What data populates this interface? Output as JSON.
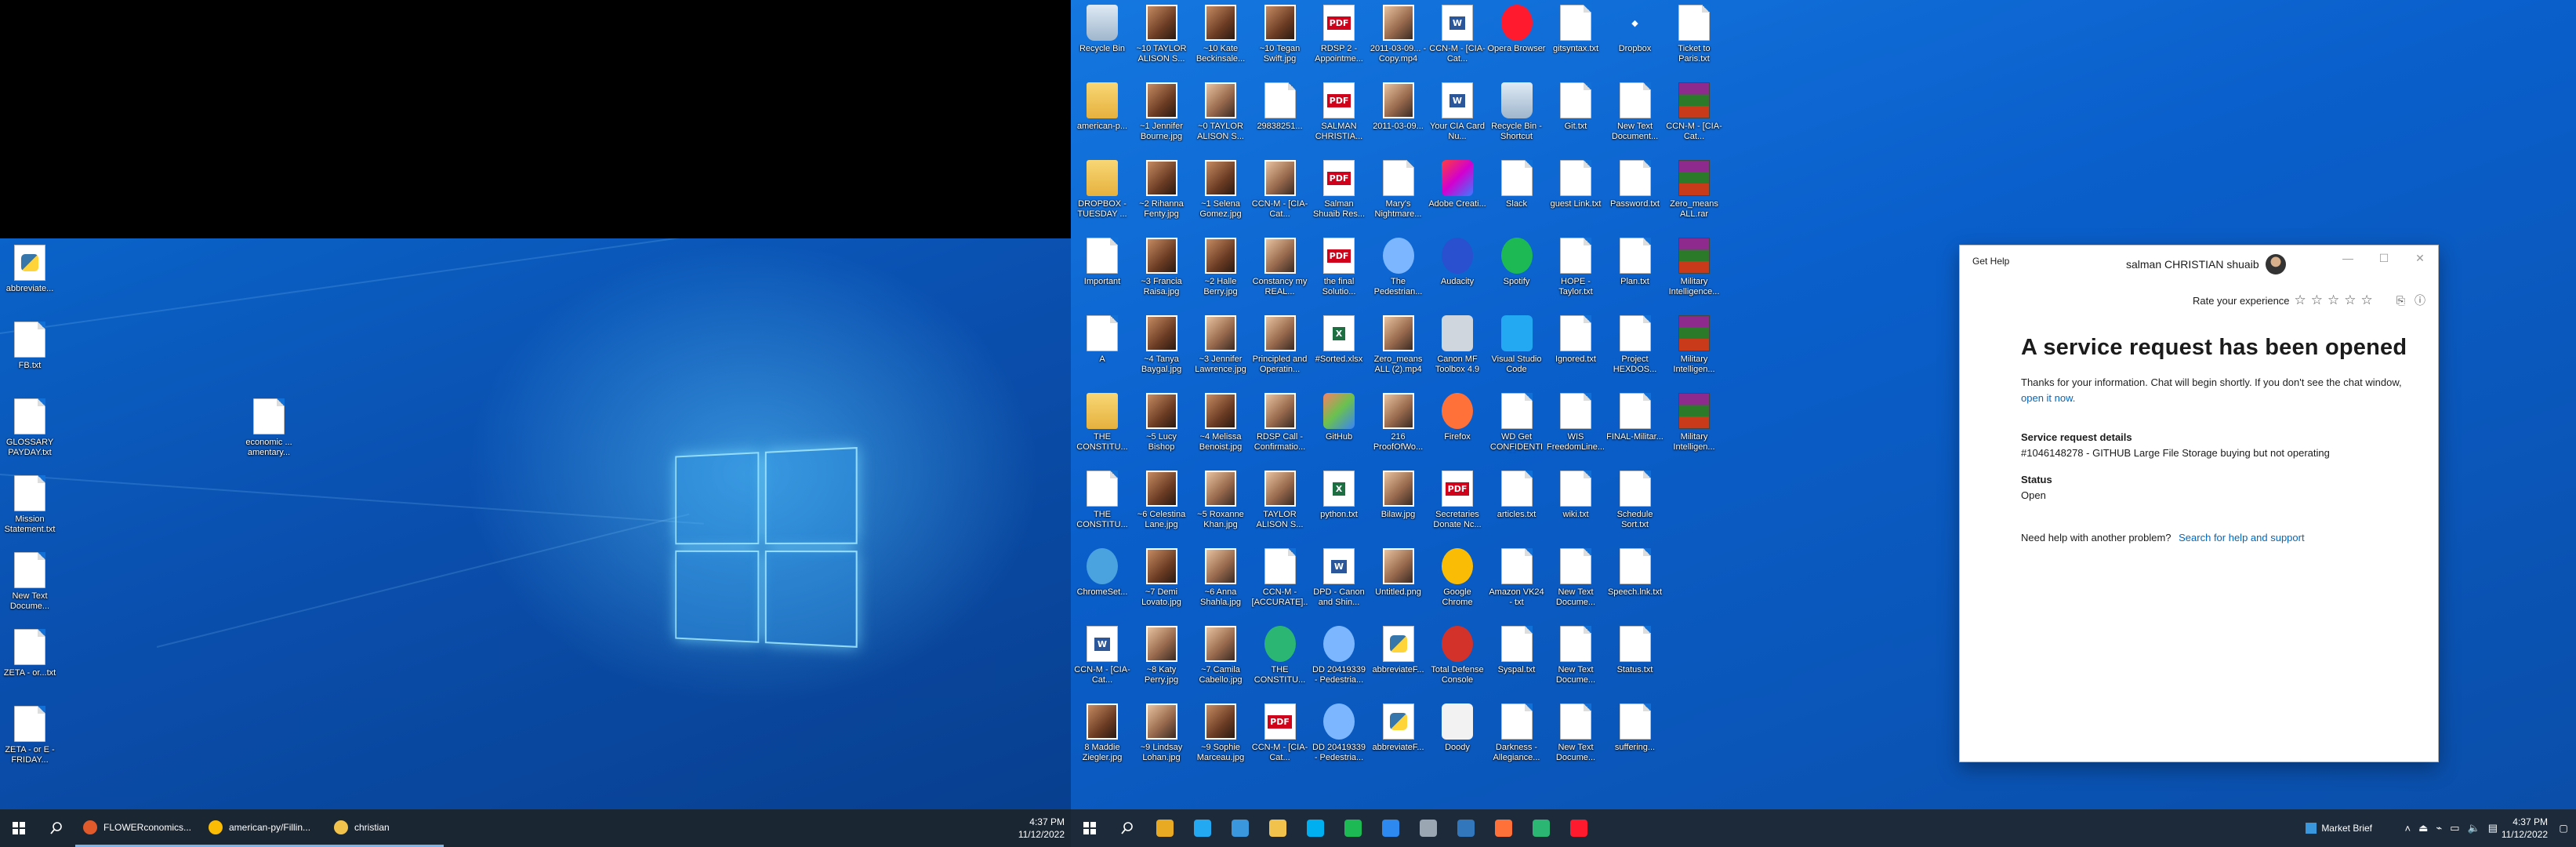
{
  "left_monitor": {
    "desktop_icons": [
      {
        "label": "abbreviate...",
        "kind": "python"
      },
      {
        "label": "FB.txt",
        "kind": "doc"
      },
      {
        "label": "GLOSSARY PAYDAY.txt",
        "kind": "doc"
      },
      {
        "label": "Mission Statement.txt",
        "kind": "doc"
      },
      {
        "label": "New Text Docume...",
        "kind": "doc"
      },
      {
        "label": "ZETA - or...txt",
        "kind": "doc"
      },
      {
        "label": "ZETA - or E - FRIDAY...",
        "kind": "doc"
      },
      {
        "label": "economic ... amentary...",
        "kind": "doc"
      }
    ],
    "taskbar": {
      "apps": [
        {
          "label": "FLOWERconomics...",
          "color": "#e05a2b"
        },
        {
          "label": "american-py/Fillin...",
          "color": "#fbbc05"
        },
        {
          "label": "christian",
          "color": "#f1c34d"
        }
      ],
      "time": "4:37 PM",
      "date": "11/12/2022"
    }
  },
  "right_monitor": {
    "desktop_icons": [
      {
        "label": "Recycle Bin",
        "kind": "bin"
      },
      {
        "label": "~10 TAYLOR ALISON S...",
        "kind": "img"
      },
      {
        "label": "~10 Kate Beckinsale...",
        "kind": "img"
      },
      {
        "label": "~10 Tegan Swift.jpg",
        "kind": "img"
      },
      {
        "label": "RDSP 2 - Appointme...",
        "kind": "pdf"
      },
      {
        "label": "2011-03-09... - Copy.mp4",
        "kind": "img2"
      },
      {
        "label": "CCN-M - [CIA-Cat...",
        "kind": "word"
      },
      {
        "label": "Opera Browser",
        "kind": "opera"
      },
      {
        "label": "gitsyntax.txt",
        "kind": "doc"
      },
      {
        "label": "Dropbox",
        "kind": "dropbox"
      },
      {
        "label": "Ticket to Paris.txt",
        "kind": "doc"
      },
      {
        "label": "american-p...",
        "kind": "folder"
      },
      {
        "label": "~1 Jennifer Bourne.jpg",
        "kind": "img"
      },
      {
        "label": "~0 TAYLOR ALISON S...",
        "kind": "img2"
      },
      {
        "label": "29838251...",
        "kind": "doc"
      },
      {
        "label": "SALMAN CHRISTIA...",
        "kind": "pdf"
      },
      {
        "label": "2011-03-09...",
        "kind": "img2"
      },
      {
        "label": "Your CIA Card Nu...",
        "kind": "word"
      },
      {
        "label": "Recycle Bin - Shortcut",
        "kind": "bin"
      },
      {
        "label": "Git.txt",
        "kind": "doc"
      },
      {
        "label": "New Text Document...",
        "kind": "doc"
      },
      {
        "label": "CCN-M - [CIA-Cat...",
        "kind": "rar"
      },
      {
        "label": "DROPBOX - TUESDAY ...",
        "kind": "folder"
      },
      {
        "label": "~2 Rihanna Fenty.jpg",
        "kind": "img"
      },
      {
        "label": "~1 Selena Gomez.jpg",
        "kind": "img"
      },
      {
        "label": "CCN-M - [CIA-Cat...",
        "kind": "img2"
      },
      {
        "label": "Salman Shuaib Res...",
        "kind": "pdf"
      },
      {
        "label": "Mary's Nightmare...",
        "kind": "doc"
      },
      {
        "label": "Adobe Creati...",
        "kind": "adobe"
      },
      {
        "label": "Slack",
        "kind": "doc"
      },
      {
        "label": "guest Link.txt",
        "kind": "doc"
      },
      {
        "label": "Password.txt",
        "kind": "doc"
      },
      {
        "label": "Zero_means ALL.rar",
        "kind": "rar"
      },
      {
        "label": "Important",
        "kind": "pdf2"
      },
      {
        "label": "~3 Francia Raisa.jpg",
        "kind": "img"
      },
      {
        "label": "~2 Halle Berry.jpg",
        "kind": "img"
      },
      {
        "label": "Constancy my REAL...",
        "kind": "img2"
      },
      {
        "label": "the final Solutio...",
        "kind": "pdf"
      },
      {
        "label": "The Pedestrian...",
        "kind": "cortana"
      },
      {
        "label": "Audacity",
        "kind": "audacity"
      },
      {
        "label": "Spotify",
        "kind": "spotify"
      },
      {
        "label": "HOPE - Taylor.txt",
        "kind": "doc"
      },
      {
        "label": "Plan.txt",
        "kind": "doc"
      },
      {
        "label": "Military Intelligence...",
        "kind": "rar"
      },
      {
        "label": "A",
        "kind": "pdf2"
      },
      {
        "label": "~4 Tanya Baygal.jpg",
        "kind": "img"
      },
      {
        "label": "~3 Jennifer Lawrence.jpg",
        "kind": "img2"
      },
      {
        "label": "Principled and Operatin...",
        "kind": "img2"
      },
      {
        "label": "#Sorted.xlsx",
        "kind": "excel"
      },
      {
        "label": "Zero_means ALL (2).mp4",
        "kind": "img2"
      },
      {
        "label": "Canon MF Toolbox 4.9",
        "kind": "canon"
      },
      {
        "label": "Visual Studio Code",
        "kind": "vscode"
      },
      {
        "label": "Ignored.txt",
        "kind": "doc"
      },
      {
        "label": "Project HEXDOS...",
        "kind": "doc"
      },
      {
        "label": "Military Intelligen...",
        "kind": "rar"
      },
      {
        "label": "THE CONSTITU...",
        "kind": "folder"
      },
      {
        "label": "~5 Lucy Bishop",
        "kind": "img"
      },
      {
        "label": "~4 Melissa Benoist.jpg",
        "kind": "img"
      },
      {
        "label": "RDSP Call - Confirmatio...",
        "kind": "img2"
      },
      {
        "label": "GitHub",
        "kind": "github"
      },
      {
        "label": "216 ProofOfWo...",
        "kind": "img2"
      },
      {
        "label": "Firefox",
        "kind": "firefox"
      },
      {
        "label": "WD Get CONFIDENTIAL...",
        "kind": "doc"
      },
      {
        "label": "WIS FreedomLine...",
        "kind": "doc"
      },
      {
        "label": "FINAL-Militar...",
        "kind": "doc"
      },
      {
        "label": "Military Intelligen...",
        "kind": "rar"
      },
      {
        "label": "THE CONSTITU...",
        "kind": "pdf2"
      },
      {
        "label": "~6 Celestina Lane.jpg",
        "kind": "img"
      },
      {
        "label": "~5 Roxanne Khan.jpg",
        "kind": "img2"
      },
      {
        "label": "TAYLOR ALISON S...",
        "kind": "img2"
      },
      {
        "label": "python.txt",
        "kind": "excel"
      },
      {
        "label": "Bilaw.jpg",
        "kind": "img2"
      },
      {
        "label": "Secretaries Donate Nc...",
        "kind": "pdf"
      },
      {
        "label": "articles.txt",
        "kind": "doc"
      },
      {
        "label": "wiki.txt",
        "kind": "doc"
      },
      {
        "label": "Schedule Sort.txt",
        "kind": "doc"
      },
      {
        "label": "ChromeSet...",
        "kind": "chromeset"
      },
      {
        "label": "~7 Demi Lovato.jpg",
        "kind": "img"
      },
      {
        "label": "~6 Anna Shahla.jpg",
        "kind": "img2"
      },
      {
        "label": "CCN-M - [ACCURATE]...",
        "kind": "doc"
      },
      {
        "label": "DPD - Canon and Shin...",
        "kind": "word"
      },
      {
        "label": "Untitled.png",
        "kind": "img2"
      },
      {
        "label": "Google Chrome",
        "kind": "chrome"
      },
      {
        "label": "Amazon VK24 - txt",
        "kind": "doc"
      },
      {
        "label": "New Text Docume...",
        "kind": "doc"
      },
      {
        "label": "Speech.lnk.txt",
        "kind": "doc"
      },
      {
        "label": "CCN-M - [CIA-Cat...",
        "kind": "word"
      },
      {
        "label": "~8 Katy Perry.jpg",
        "kind": "img2"
      },
      {
        "label": "~7 Camila Cabello.jpg",
        "kind": "img2"
      },
      {
        "label": "THE CONSTITU...",
        "kind": "edge"
      },
      {
        "label": "DD 20419339 - Pedestria...",
        "kind": "cortana"
      },
      {
        "label": "abbreviateF...",
        "kind": "python"
      },
      {
        "label": "Total Defense Console",
        "kind": "total"
      },
      {
        "label": "Syspal.txt",
        "kind": "doc"
      },
      {
        "label": "New Text Docume...",
        "kind": "doc"
      },
      {
        "label": "Status.txt",
        "kind": "doc"
      },
      {
        "label": "8 Maddie Ziegler.jpg",
        "kind": "img"
      },
      {
        "label": "~9 Lindsay Lohan.jpg",
        "kind": "img2"
      },
      {
        "label": "~9 Sophie Marceau.jpg",
        "kind": "img"
      },
      {
        "label": "CCN-M - [CIA-Cat...",
        "kind": "pdf"
      },
      {
        "label": "DD 20419339 - Pedestria...",
        "kind": "cortana"
      },
      {
        "label": "abbreviateF...",
        "kind": "python"
      },
      {
        "label": "Doody",
        "kind": "doody"
      },
      {
        "label": "Darkness - Allegiance...",
        "kind": "doc"
      },
      {
        "label": "New Text Docume...",
        "kind": "doc"
      },
      {
        "label": "suffering...",
        "kind": "doc"
      }
    ],
    "get_help": {
      "title": "Get Help",
      "user_name": "salman CHRISTIAN shuaib",
      "rate_label": "Rate your experience",
      "heading": "A service request has been opened",
      "info_text": "Thanks for your information. Chat will begin shortly. If you don't see the chat window,",
      "open_link": "open it now.",
      "details_label": "Service request details",
      "details_value": "#1046148278 - GITHUB Large File Storage buying but not operating",
      "status_label": "Status",
      "status_value": "Open",
      "help_prompt": "Need help with another problem?",
      "help_link": "Search for help and support"
    },
    "taskbar": {
      "tray_text": "Market Brief",
      "time": "4:37 PM",
      "date": "11/12/2022",
      "pinned": [
        {
          "name": "chrome",
          "color": "#e8a923"
        },
        {
          "name": "vscode",
          "color": "#23a8f2"
        },
        {
          "name": "desktop-app",
          "color": "#3a96dd"
        },
        {
          "name": "file-explorer",
          "color": "#f1c34d"
        },
        {
          "name": "skype",
          "color": "#00aff0"
        },
        {
          "name": "spotify",
          "color": "#1db954"
        },
        {
          "name": "snip",
          "color": "#2d89ef"
        },
        {
          "name": "calendar",
          "color": "#9aa6b2"
        },
        {
          "name": "edge-legacy",
          "color": "#3277bc"
        },
        {
          "name": "firefox",
          "color": "#ff7139"
        },
        {
          "name": "edge",
          "color": "#2bb673"
        },
        {
          "name": "opera",
          "color": "#ff1b2d"
        }
      ]
    }
  }
}
